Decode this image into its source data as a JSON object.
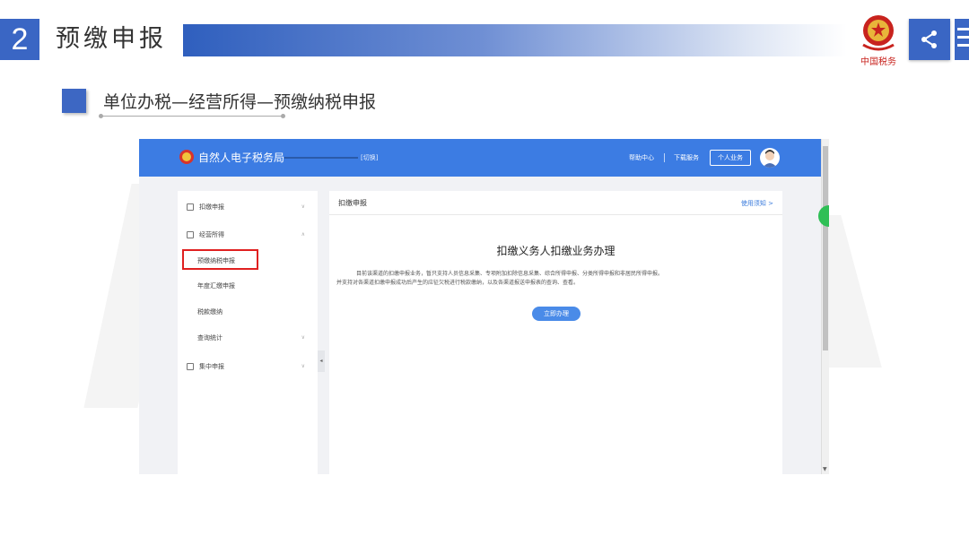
{
  "slide": {
    "number": "2",
    "title": "预缴申报",
    "section_title": "单位办税—经营所得—预缴纳税申报"
  },
  "colors": {
    "accent": "#3a66c4",
    "site_header": "#3c7ce3",
    "highlight": "#e02020",
    "button": "#4a8be8"
  },
  "icons": {
    "share": "share-icon",
    "menu": "menu-icon",
    "emblem": "tax-emblem-icon"
  },
  "site": {
    "name": "自然人电子税务局",
    "switch": "[切换]",
    "help": "帮助中心",
    "download": "下载服务",
    "personal": "个人业务"
  },
  "sidebar": {
    "items": [
      {
        "label": "扣缴申报"
      },
      {
        "label": "经营所得"
      },
      {
        "label": "集中申报"
      }
    ],
    "sub_items": [
      {
        "label": "预缴纳税申报"
      },
      {
        "label": "年度汇缴申报"
      },
      {
        "label": "税款缴纳"
      },
      {
        "label": "查询统计"
      }
    ]
  },
  "main": {
    "panel_title": "扣缴申报",
    "guide_link": "使用须知 >",
    "heading": "扣缴义务人扣缴业务办理",
    "desc_line1": "目前该渠道的扣缴申报业务，暂只支持人员信息采集、专项附加扣除信息采集、综合所得申报、分类所得申报和非居民所得申报。",
    "desc_line2": "并支持对各渠道扣缴申报成功后产生的应征欠税进行税款缴纳，以及各渠道报送申报表的查询、查看。",
    "start_button": "立即办理"
  }
}
